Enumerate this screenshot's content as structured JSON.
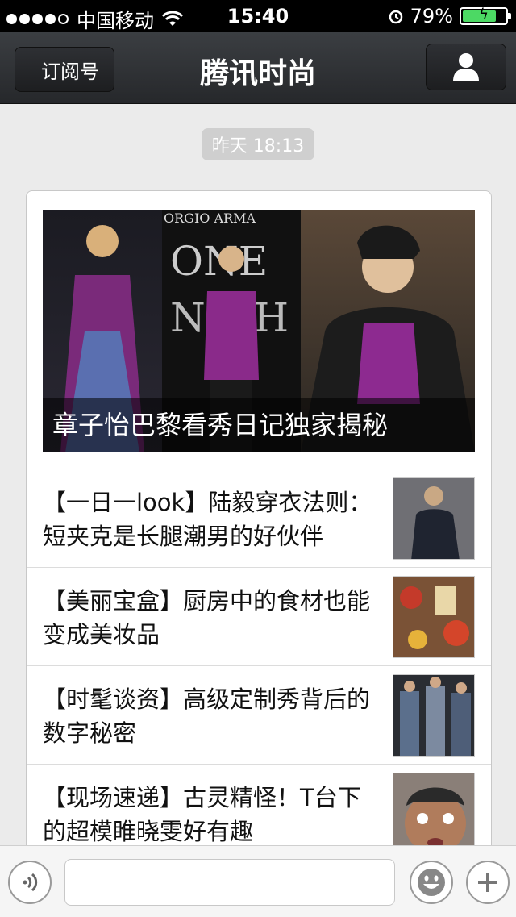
{
  "status_bar": {
    "carrier": "中国移动",
    "time": "15:40",
    "battery_percent": "79%",
    "battery_level": 0.79,
    "signal_bars": 4
  },
  "nav": {
    "back_label": "订阅号",
    "title": "腾讯时尚",
    "profile_icon": "person-icon"
  },
  "timestamp": "昨天 18:13",
  "hero": {
    "caption": "章子怡巴黎看秀日记独家揭秘",
    "brand_text": "ORGIO ARMA"
  },
  "articles": [
    {
      "title": "【一日一look】陆毅穿衣法则：短夹克是长腿潮男的好伙伴"
    },
    {
      "title": "【美丽宝盒】厨房中的食材也能变成美妆品"
    },
    {
      "title": "【时髦谈资】高级定制秀背后的数字秘密"
    },
    {
      "title": "【现场速递】古灵精怪！T台下的超模睢晓雯好有趣"
    }
  ],
  "input_bar": {
    "voice_icon": "voice-icon",
    "emoji_icon": "emoji-icon",
    "plus_icon": "plus-icon",
    "placeholder": ""
  }
}
